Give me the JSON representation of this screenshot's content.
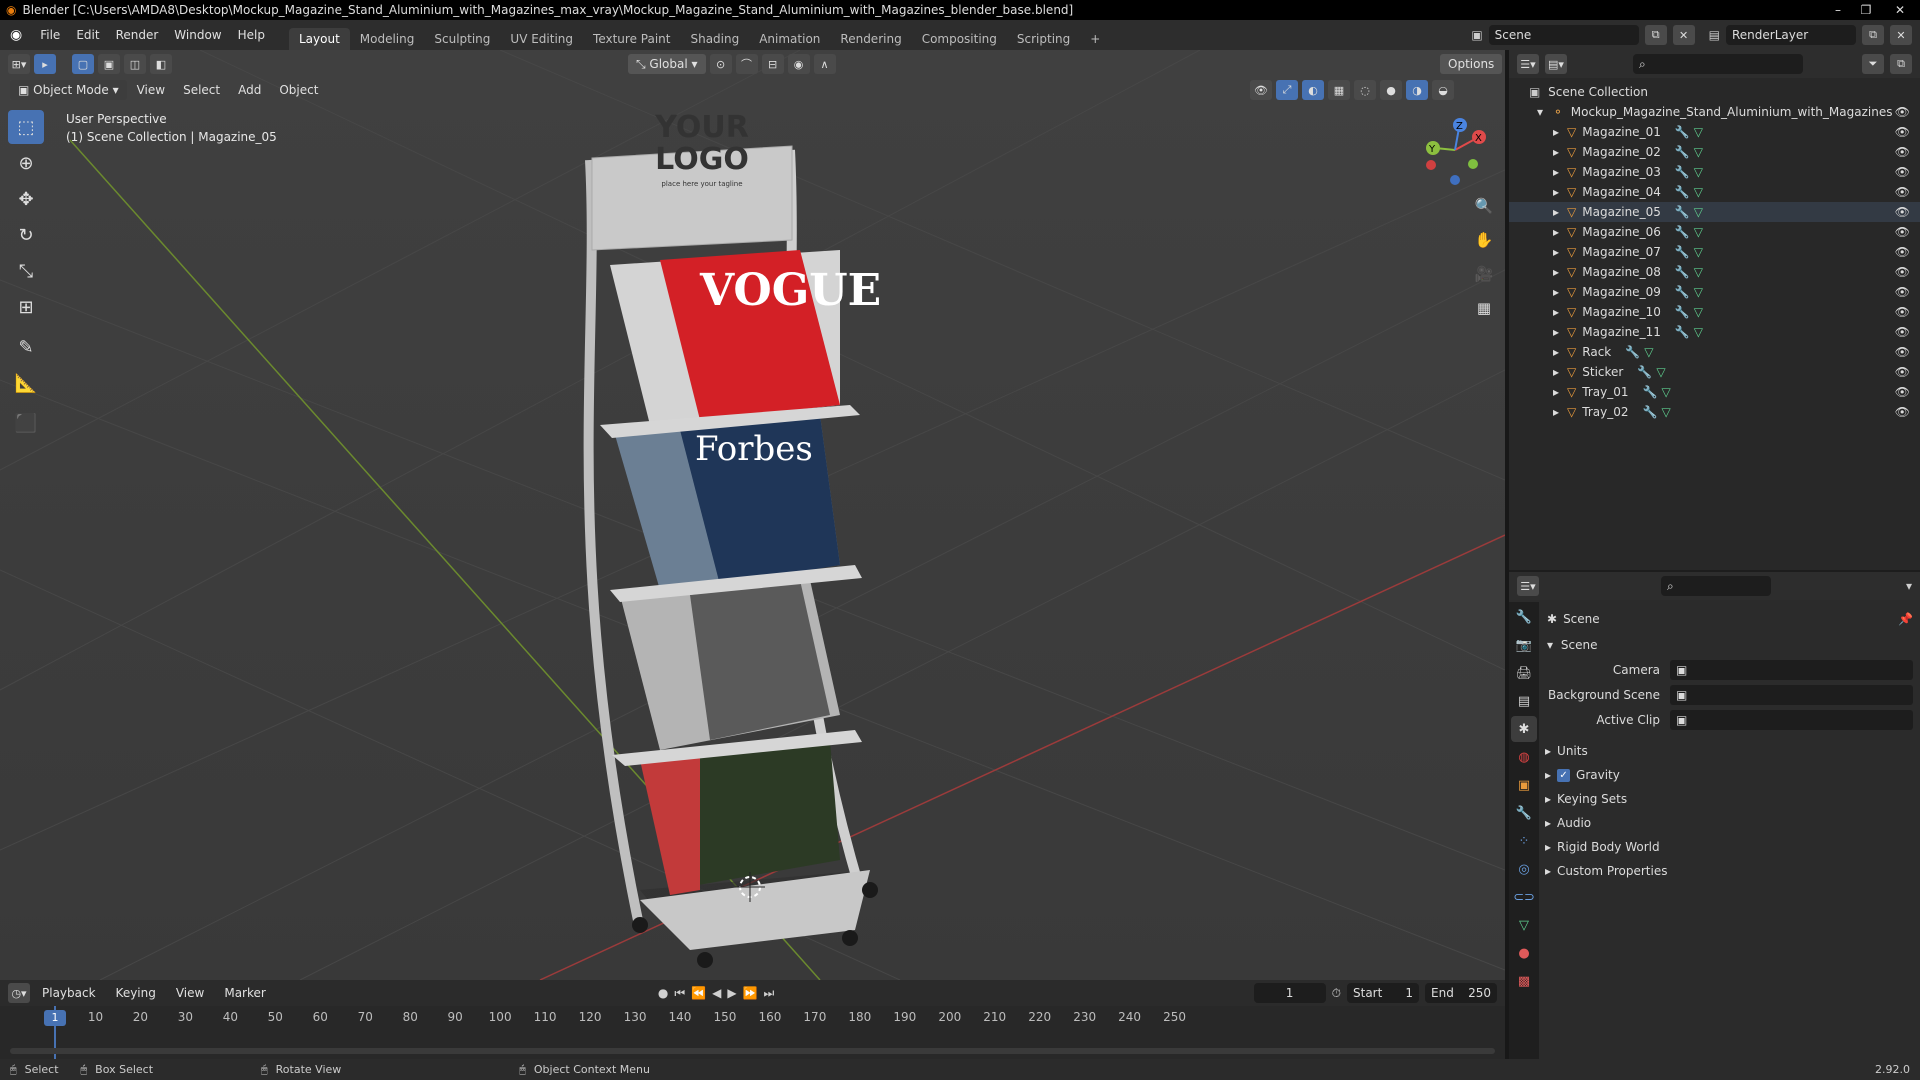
{
  "window": {
    "title": "Blender [C:\\Users\\AMDA8\\Desktop\\Mockup_Magazine_Stand_Aluminium_with_Magazines_max_vray\\Mockup_Magazine_Stand_Aluminium_with_Magazines_blender_base.blend]"
  },
  "menu": [
    "File",
    "Edit",
    "Render",
    "Window",
    "Help"
  ],
  "workspaces": [
    "Layout",
    "Modeling",
    "Sculpting",
    "UV Editing",
    "Texture Paint",
    "Shading",
    "Animation",
    "Rendering",
    "Compositing",
    "Scripting"
  ],
  "active_workspace": "Layout",
  "scene_name": "Scene",
  "render_layer": "RenderLayer",
  "header": {
    "transform_orientation": "Global",
    "options_label": "Options"
  },
  "viewport": {
    "mode": "Object Mode",
    "menus": [
      "View",
      "Select",
      "Add",
      "Object"
    ],
    "perspective_label": "User Perspective",
    "collection_label": "(1) Scene Collection | Magazine_05",
    "logo_text_1": "YOUR",
    "logo_text_2": "LOGO",
    "logo_tagline": "place here your tagline",
    "accent_color": "#4772b3",
    "gizmo_axes": [
      "X",
      "Y",
      "Z"
    ]
  },
  "outliner": {
    "root": "Scene Collection",
    "collection": "Mockup_Magazine_Stand_Aluminium_with_Magazines",
    "objects": [
      "Magazine_01",
      "Magazine_02",
      "Magazine_03",
      "Magazine_04",
      "Magazine_05",
      "Magazine_06",
      "Magazine_07",
      "Magazine_08",
      "Magazine_09",
      "Magazine_10",
      "Magazine_11",
      "Rack",
      "Sticker",
      "Tray_01",
      "Tray_02"
    ],
    "selected": "Magazine_05"
  },
  "properties": {
    "context": "Scene",
    "panel": "Scene",
    "fields": [
      {
        "label": "Camera",
        "value": ""
      },
      {
        "label": "Background Scene",
        "value": ""
      },
      {
        "label": "Active Clip",
        "value": ""
      }
    ],
    "subpanels": [
      "Units",
      "Gravity",
      "Keying Sets",
      "Audio",
      "Rigid Body World",
      "Custom Properties"
    ],
    "gravity_checked": true
  },
  "timeline": {
    "menus": [
      "Playback",
      "Keying",
      "View",
      "Marker"
    ],
    "current_frame": "1",
    "start_label": "Start",
    "start": "1",
    "end_label": "End",
    "end": "250",
    "ticks": [
      "1",
      "10",
      "20",
      "30",
      "40",
      "50",
      "60",
      "70",
      "80",
      "90",
      "100",
      "110",
      "120",
      "130",
      "140",
      "150",
      "160",
      "170",
      "180",
      "190",
      "200",
      "210",
      "220",
      "230",
      "240",
      "250"
    ]
  },
  "statusbar": {
    "select": "Select",
    "box_select": "Box Select",
    "rotate_view": "Rotate View",
    "context_menu": "Object Context Menu",
    "version": "2.92.0"
  }
}
